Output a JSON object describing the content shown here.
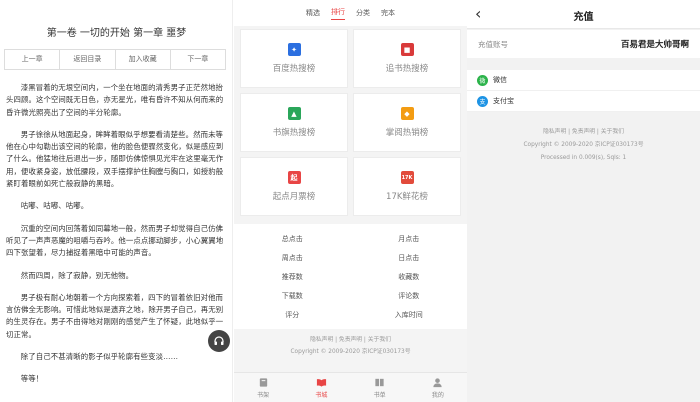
{
  "reader": {
    "chapter_title": "第一卷 一切的开始 第一章 噩梦",
    "nav": [
      "上一章",
      "返回目录",
      "加入收藏",
      "下一章"
    ],
    "paragraphs": [
      "漆黑冒着的无垠空间内，一个坐在地面的清秀男子正茫然地抬头四顾。这个空间既无日色，亦无星光，唯有昏许不知从何而来的昏许微光照亮出了空间的半分轮廓。",
      "男子徐徐从地面起身，眸眸着眼似乎想要看清楚些。然而未等他在心中勾勒出该空间的轮廓，他的脸色便骤然变化，似是感应到了什么。他猛地往后退出一步，随即仿佛惊惧见光牢在这里毫无作用，便收紧身姿，放低腰段，双手摆撑护住胸膛与胸口，如授豹般紧盯着眼前如死亡般寂静的黑暗。",
      "咕嘟、咕嘟、咕嘟。",
      "沉重的空间内回荡着如同幕地一般，然而男子却觉得自己仿佛听见了一声声恶魔的咀嚼与吞吟。他一点点挪动脚步，小心翼翼地四下张望着，尽力捕捉着黑暗中可能的声音。",
      "然而四周，除了寂静，别无他物。",
      "男子极有耐心地朝着一个方向探索着，四下的冒着依旧对他而言仿佛全无影响。可惜此地似是遗弃之地，除开男子自己，再无别的生灵存在。男子不由得地对刚刚的感觉产生了怀疑，此地似乎一切正常。",
      "除了自己不甚清晰的影子似乎轮廓有些变淡……",
      "等等！"
    ]
  },
  "rank": {
    "tabs": [
      "精选",
      "排行",
      "分类",
      "完本"
    ],
    "active_tab": "排行",
    "cards": [
      {
        "label": "百度热搜榜",
        "icon": "paw-icon",
        "color": "#2b6fe0"
      },
      {
        "label": "追书热搜榜",
        "icon": "book-red-icon",
        "color": "#d93a3a"
      },
      {
        "label": "书旗热搜榜",
        "icon": "flag-icon",
        "color": "#2aa65a"
      },
      {
        "label": "掌阅热销榜",
        "icon": "leaf-icon",
        "color": "#f39c12"
      },
      {
        "label": "起点月票榜",
        "icon": "qidian-icon",
        "color": "#e84545"
      },
      {
        "label": "17K鲜花榜",
        "icon": "17k-icon",
        "color": "#e24b3b"
      }
    ],
    "card_glyphs": [
      "✦",
      "■",
      "▲",
      "◆",
      "起",
      "17K"
    ],
    "metrics": [
      "总点击",
      "月点击",
      "周点击",
      "日点击",
      "推荐数",
      "收藏数",
      "下载数",
      "评论数",
      "评分",
      "入库时间"
    ],
    "footer_links": "隐私声明 | 免责声明 | 关于我们",
    "footer_copy": "Copyright © 2009-2020 京ICP证030173号",
    "bottom_nav": [
      "书架",
      "书城",
      "书单",
      "我的"
    ],
    "bottom_active": "书城"
  },
  "recharge": {
    "title": "充值",
    "back_glyph": "‹",
    "account_label": "充值账号",
    "account_value": "百易君是大帅哥啊",
    "payments": [
      {
        "label": "微信",
        "icon": "wechat-icon",
        "color": "#2bb34a"
      },
      {
        "label": "支付宝",
        "icon": "alipay-icon",
        "color": "#1d93e4"
      }
    ],
    "pay_glyphs": [
      "微",
      "支"
    ],
    "footer_links": "隐私声明 | 免责声明 | 关于我们",
    "footer_copy": "Copyright © 2009-2020 京ICP证030173号",
    "footer_processed": "Processed in 0.009(s), Sqls: 1"
  },
  "audio_icon": "headphones-icon"
}
